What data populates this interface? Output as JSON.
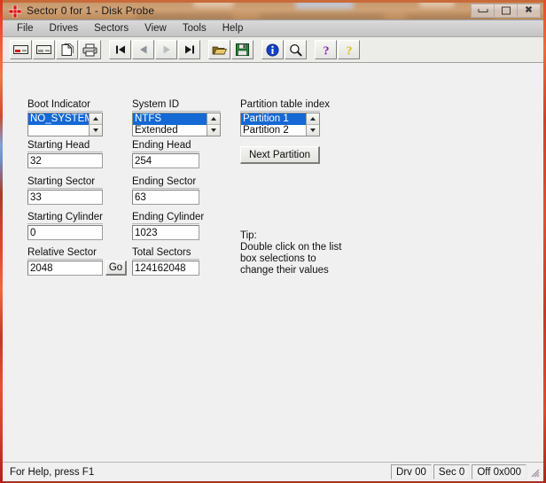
{
  "window": {
    "title": "Sector 0 for 1 - Disk Probe",
    "app_icon_name": "disk-probe-red-cross-icon",
    "controls": {
      "minimize": "Minimize",
      "maximize": "Maximize",
      "close": "Close"
    }
  },
  "menu": {
    "items": [
      {
        "label": "File"
      },
      {
        "label": "Drives"
      },
      {
        "label": "Sectors"
      },
      {
        "label": "View"
      },
      {
        "label": "Tools"
      },
      {
        "label": "Help"
      }
    ]
  },
  "toolbar": {
    "groups": [
      {
        "buttons": [
          {
            "name": "open-physical-drive-button",
            "icon": "physical-drive-icon"
          },
          {
            "name": "open-logical-drive-button",
            "icon": "logical-drive-icon"
          },
          {
            "name": "new-document-button",
            "icon": "document-icon"
          },
          {
            "name": "print-button",
            "icon": "printer-icon"
          }
        ]
      },
      {
        "buttons": [
          {
            "name": "first-sector-button",
            "icon": "skip-to-first-icon"
          },
          {
            "name": "previous-sector-button",
            "icon": "previous-icon"
          },
          {
            "name": "next-sector-button",
            "icon": "next-icon"
          },
          {
            "name": "last-sector-button",
            "icon": "skip-to-last-icon"
          }
        ]
      },
      {
        "buttons": [
          {
            "name": "open-file-button",
            "icon": "open-folder-icon"
          },
          {
            "name": "save-button",
            "icon": "floppy-disk-icon"
          }
        ]
      },
      {
        "buttons": [
          {
            "name": "info-button",
            "icon": "info-circle-icon"
          },
          {
            "name": "find-button",
            "icon": "magnifier-icon"
          }
        ]
      },
      {
        "buttons": [
          {
            "name": "help-button",
            "icon": "question-mark-purple-icon"
          },
          {
            "name": "context-help-button",
            "icon": "question-mark-yellow-icon"
          }
        ]
      }
    ]
  },
  "form": {
    "boot_indicator": {
      "label": "Boot Indicator",
      "options": [
        "NO_SYSTEM",
        ""
      ],
      "selected": "NO_SYSTEM"
    },
    "system_id": {
      "label": "System ID",
      "options": [
        "NTFS",
        "Extended"
      ],
      "selected": "NTFS"
    },
    "partition_table_index": {
      "label": "Partition table index",
      "options": [
        "Partition 1",
        "Partition 2"
      ],
      "selected": "Partition 1"
    },
    "starting_head": {
      "label": "Starting Head",
      "value": "32"
    },
    "ending_head": {
      "label": "Ending Head",
      "value": "254"
    },
    "starting_sector": {
      "label": "Starting Sector",
      "value": "33"
    },
    "ending_sector": {
      "label": "Ending Sector",
      "value": "63"
    },
    "starting_cylinder": {
      "label": "Starting Cylinder",
      "value": "0"
    },
    "ending_cylinder": {
      "label": "Ending Cylinder",
      "value": "1023"
    },
    "relative_sector": {
      "label": "Relative Sector",
      "value": "2048"
    },
    "total_sectors": {
      "label": "Total Sectors",
      "value": "124162048"
    },
    "go_button": "Go",
    "next_partition_button": "Next Partition",
    "tip": {
      "heading": "Tip:",
      "line1": "Double click on the list",
      "line2": "box selections to",
      "line3": "change their values"
    }
  },
  "status_bar": {
    "help_text": "For Help, press F1",
    "panels": [
      {
        "name": "drive-panel",
        "text": "Drv  00"
      },
      {
        "name": "sector-panel",
        "text": "Sec 0"
      },
      {
        "name": "offset-panel",
        "text": "Off 0x000"
      }
    ]
  },
  "colors": {
    "selection_blue": "#1569d4",
    "frame_red": "#c04028",
    "client_gray": "#f0f0f0",
    "title_glass_tan": "#c7996e"
  }
}
